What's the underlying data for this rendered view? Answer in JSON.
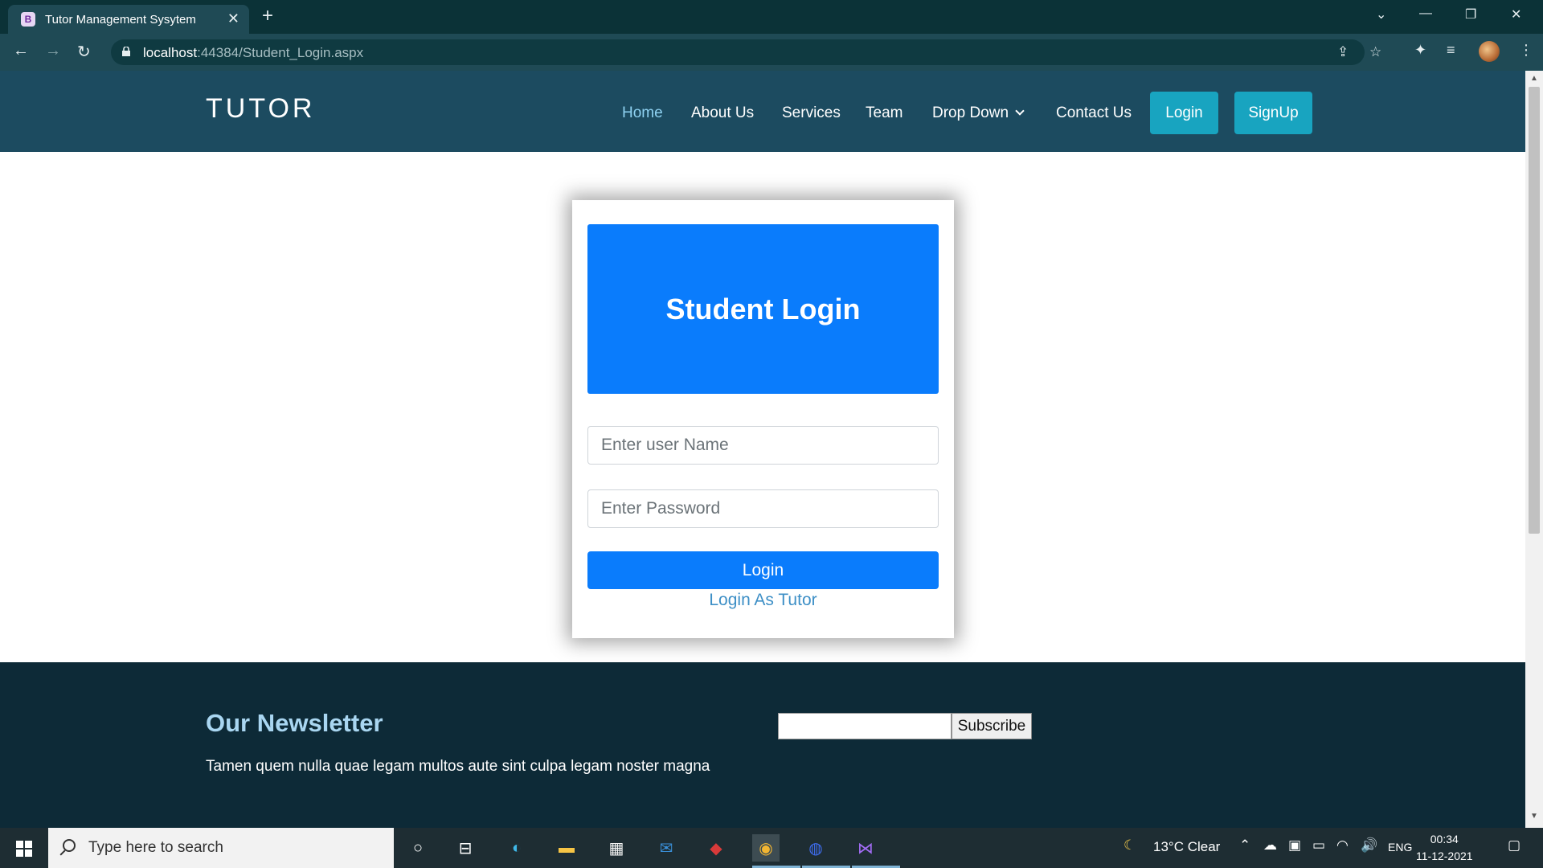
{
  "browser": {
    "tab_title": "Tutor Management Sysytem",
    "tab_favicon": "B",
    "url_host": "localhost",
    "url_rest": ":44384/Student_Login.aspx"
  },
  "header": {
    "brand": "TUTOR",
    "nav": [
      "Home",
      "About Us",
      "Services",
      "Team",
      "Drop Down",
      "Contact Us"
    ],
    "login_label": "Login",
    "signup_label": "SignUp"
  },
  "login_card": {
    "title": "Student Login",
    "username_placeholder": "Enter user Name",
    "password_placeholder": "Enter Password",
    "login_button": "Login",
    "alt_link": "Login As Tutor"
  },
  "footer": {
    "newsletter_title": "Our Newsletter",
    "newsletter_text": "Tamen quem nulla quae legam multos aute sint culpa legam noster magna",
    "subscribe_label": "Subscribe"
  },
  "taskbar": {
    "search_placeholder": "Type here to search",
    "weather": "13°C  Clear",
    "language": "ENG",
    "time": "00:34",
    "date": "11-12-2021"
  },
  "colors": {
    "header_bg": "#1c4b60",
    "accent_blue": "#0a7cfc",
    "header_button": "#18a4c0",
    "footer_bg": "#0d2a37"
  }
}
